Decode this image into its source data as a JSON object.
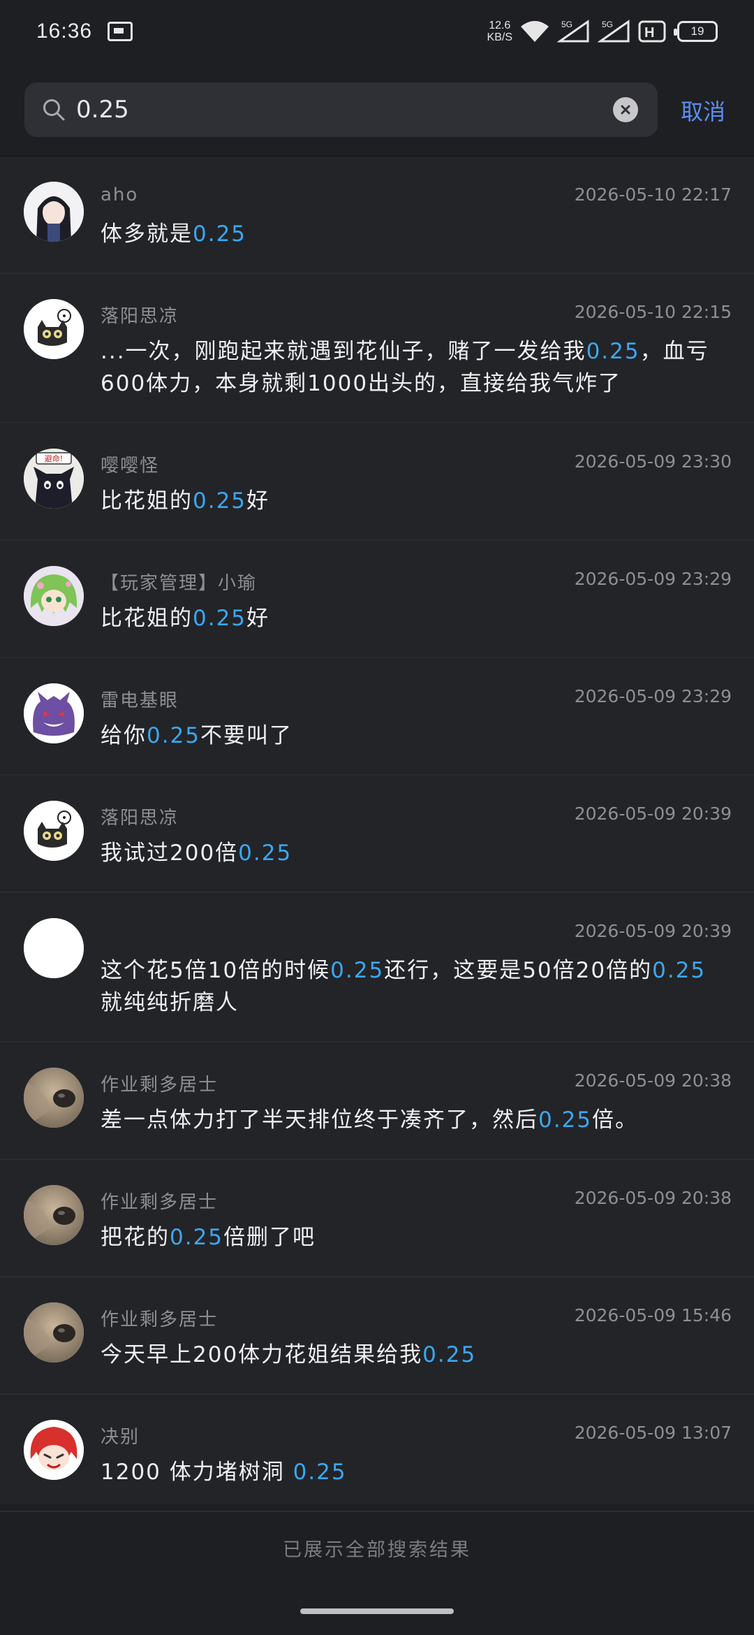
{
  "status_bar": {
    "time": "16:36",
    "net_speed_value": "12.6",
    "net_speed_unit": "KB/S",
    "sim1_label": "5G",
    "sim2_label": "5G",
    "hd_label": "H",
    "battery": "19",
    "icons": [
      "notification-image-icon",
      "wifi-icon",
      "signal-icon",
      "signal-icon",
      "hd-icon",
      "battery-icon"
    ]
  },
  "search": {
    "query": "0.25",
    "placeholder": "",
    "cancel_label": "取消"
  },
  "colors": {
    "background": "#1e1f23",
    "list_background": "#232428",
    "highlight": "#3aa8f0",
    "accent": "#5b8ef0",
    "secondary_text": "#8e8f94"
  },
  "results": [
    {
      "name": "aho",
      "time": "2026-05-10 22:17",
      "avatar": "anime-girl-avatar",
      "segments": [
        [
          "体多就是",
          false
        ],
        [
          "0.25",
          true
        ]
      ]
    },
    {
      "name": "落阳思凉",
      "time": "2026-05-10 22:15",
      "avatar": "cartoon-cat-avatar",
      "segments": [
        [
          "...一次，刚跑起来就遇到花仙子，赌了一发给我",
          false
        ],
        [
          "0.25",
          true
        ],
        [
          "，血亏600体力，本身就剩1000出头的，直接给我气炸了",
          false
        ]
      ]
    },
    {
      "name": "嘤嘤怪",
      "time": "2026-05-09 23:30",
      "avatar": "black-cat-avatar",
      "avatar_caption": "避命!",
      "segments": [
        [
          "比花姐的",
          false
        ],
        [
          "0.25",
          true
        ],
        [
          "好",
          false
        ]
      ]
    },
    {
      "name": "【玩家管理】小瑜",
      "time": "2026-05-09 23:29",
      "avatar": "green-hair-avatar",
      "segments": [
        [
          "比花姐的",
          false
        ],
        [
          "0.25",
          true
        ],
        [
          "好",
          false
        ]
      ]
    },
    {
      "name": "雷电基眼",
      "time": "2026-05-09 23:29",
      "avatar": "gengar-avatar",
      "segments": [
        [
          "给你",
          false
        ],
        [
          "0.25",
          true
        ],
        [
          "不要叫了",
          false
        ]
      ]
    },
    {
      "name": "落阳思凉",
      "time": "2026-05-09 20:39",
      "avatar": "cartoon-cat-avatar",
      "segments": [
        [
          "我试过200倍",
          false
        ],
        [
          "0.25",
          true
        ]
      ]
    },
    {
      "name": "",
      "time": "2026-05-09 20:39",
      "avatar": "blank-avatar",
      "segments": [
        [
          "这个花5倍10倍的时候",
          false
        ],
        [
          "0.25",
          true
        ],
        [
          "还行，这要是50倍20倍的",
          false
        ],
        [
          "0.25",
          true
        ],
        [
          "就纯纯折磨人",
          false
        ]
      ]
    },
    {
      "name": "作业剩多居士",
      "time": "2026-05-09 20:38",
      "avatar": "dog-photo-avatar",
      "segments": [
        [
          "差一点体力打了半天排位终于凑齐了，然后",
          false
        ],
        [
          "0.25",
          true
        ],
        [
          "倍。",
          false
        ]
      ]
    },
    {
      "name": "作业剩多居士",
      "time": "2026-05-09 20:38",
      "avatar": "dog-photo-avatar",
      "segments": [
        [
          "把花的",
          false
        ],
        [
          "0.25",
          true
        ],
        [
          "倍删了吧",
          false
        ]
      ]
    },
    {
      "name": "作业剩多居士",
      "time": "2026-05-09 15:46",
      "avatar": "dog-photo-avatar",
      "segments": [
        [
          "今天早上200体力花姐结果给我",
          false
        ],
        [
          "0.25",
          true
        ]
      ]
    },
    {
      "name": "决别",
      "time": "2026-05-09 13:07",
      "avatar": "red-hair-avatar",
      "segments": [
        [
          "1200 体力堵树洞 ",
          false
        ],
        [
          "0.25",
          true
        ]
      ]
    }
  ],
  "footer": {
    "note": "已展示全部搜索结果"
  }
}
